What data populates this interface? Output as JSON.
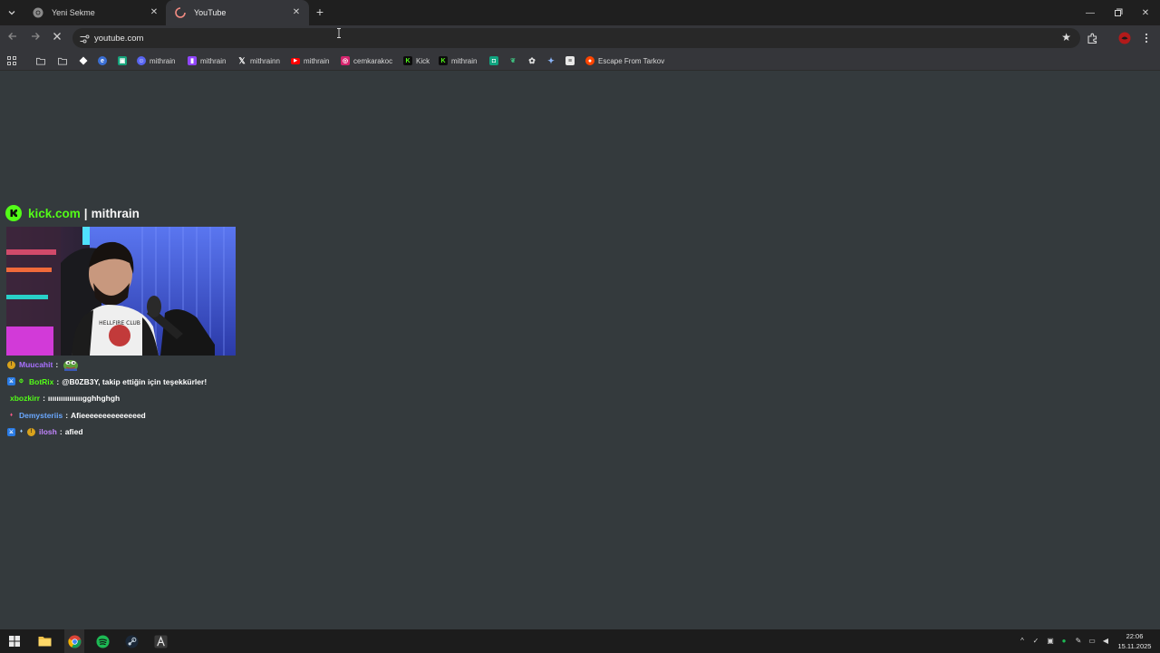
{
  "browser": {
    "tabs": [
      {
        "title": "Yeni Sekme",
        "active": false,
        "favicon": "chrome-icon"
      },
      {
        "title": "YouTube",
        "active": true,
        "favicon": "loading-spinner-icon"
      }
    ],
    "address": "youtube.com",
    "bookmarks": [
      {
        "label": "",
        "icon": "apps-grid-icon"
      },
      {
        "label": "",
        "icon": "folder-icon"
      },
      {
        "label": "",
        "icon": "folder-icon"
      },
      {
        "label": "",
        "icon": "diamond-icon"
      },
      {
        "label": "",
        "icon": "edge-icon"
      },
      {
        "label": "",
        "icon": "green-square-icon"
      },
      {
        "label": "mithrain",
        "icon": "discord-icon"
      },
      {
        "label": "mithrain",
        "icon": "twitch-icon"
      },
      {
        "label": "mithrainn",
        "icon": "x-icon"
      },
      {
        "label": "mithrain",
        "icon": "youtube-icon"
      },
      {
        "label": "cemkarakoc",
        "icon": "instagram-icon"
      },
      {
        "label": "Kick",
        "icon": "kick-icon"
      },
      {
        "label": "mithrain",
        "icon": "kick-icon"
      },
      {
        "label": "",
        "icon": "chat-icon"
      },
      {
        "label": "",
        "icon": "leaf-icon"
      },
      {
        "label": "",
        "icon": "openai-icon"
      },
      {
        "label": "",
        "icon": "gemini-icon"
      },
      {
        "label": "",
        "icon": "book-icon"
      },
      {
        "label": "Escape From Tarkov",
        "icon": "reddit-icon"
      }
    ]
  },
  "overlay": {
    "site": "kick.com",
    "separator": "|",
    "channel": "mithrain"
  },
  "chat": [
    {
      "user": "Muucahit",
      "user_color": "#a970ff",
      "message": "",
      "emote": "pepe-emote",
      "badges": [
        "sub-badge"
      ]
    },
    {
      "user": "BotRix",
      "user_color": "#53fc18",
      "message": "@B0ZB3Y, takip ettiğin için teşekkürler!",
      "badges": [
        "mod-badge",
        "bot-badge"
      ]
    },
    {
      "user": "xbozkirr",
      "user_color": "#53fc18",
      "message": "ııııııııııııııııgghhghgh",
      "badges": []
    },
    {
      "user": "Demysteriis",
      "user_color": "#6aa8ff",
      "message": "Afieeeeeeeeeeeeeed",
      "badges": [
        "gift-badge"
      ]
    },
    {
      "user": "ilosh",
      "user_color": "#c084fc",
      "message": "afied",
      "badges": [
        "mod-badge",
        "gift-badge",
        "sub-badge"
      ]
    }
  ],
  "taskbar": {
    "apps": [
      "windows-start-icon",
      "file-explorer-icon",
      "chrome-icon",
      "spotify-icon",
      "steam-icon",
      "app-a-icon"
    ],
    "time": "22:06",
    "date": "15.11.2025"
  },
  "colors": {
    "kick_green": "#53fc18",
    "page_bg": "#343a3d",
    "chrome_dark": "#1f1f1f"
  }
}
